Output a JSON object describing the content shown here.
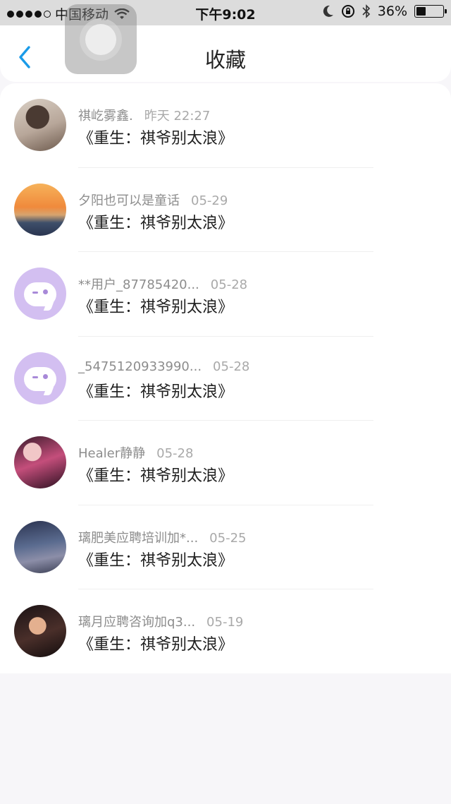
{
  "status_bar": {
    "carrier": "中国移动",
    "time": "下午9:02",
    "battery_percent": "36%",
    "battery_level": 0.36,
    "icons": [
      "signal-dots-icon",
      "wifi-icon",
      "moon-icon",
      "rotation-lock-icon",
      "bluetooth-icon",
      "battery-icon"
    ]
  },
  "header": {
    "title": "收藏",
    "back_icon": "chevron-left-icon",
    "accent_color": "#1a9be8"
  },
  "list": [
    {
      "user": "祺屹雾鑫.",
      "date": "昨天 22:27",
      "work": "《重生：祺爷别太浪》",
      "avatar": "photo-avatar"
    },
    {
      "user": "夕阳也可以是童话",
      "date": "05-29",
      "work": "《重生：祺爷别太浪》",
      "avatar": "photo-avatar"
    },
    {
      "user": "**用户_87785420...",
      "date": "05-28",
      "work": "《重生：祺爷别太浪》",
      "avatar": "default-bubble-avatar"
    },
    {
      "user": "_5475120933990...",
      "date": "05-28",
      "work": "《重生：祺爷别太浪》",
      "avatar": "default-bubble-avatar"
    },
    {
      "user": "Healer静静",
      "date": "05-28",
      "work": "《重生：祺爷别太浪》",
      "avatar": "photo-avatar"
    },
    {
      "user": "璃肥美应聘培训加*...",
      "date": "05-25",
      "work": "《重生：祺爷别太浪》",
      "avatar": "photo-avatar"
    },
    {
      "user": "璃月应聘咨询加q3...",
      "date": "05-19",
      "work": "《重生：祺爷别太浪》",
      "avatar": "photo-avatar"
    }
  ]
}
